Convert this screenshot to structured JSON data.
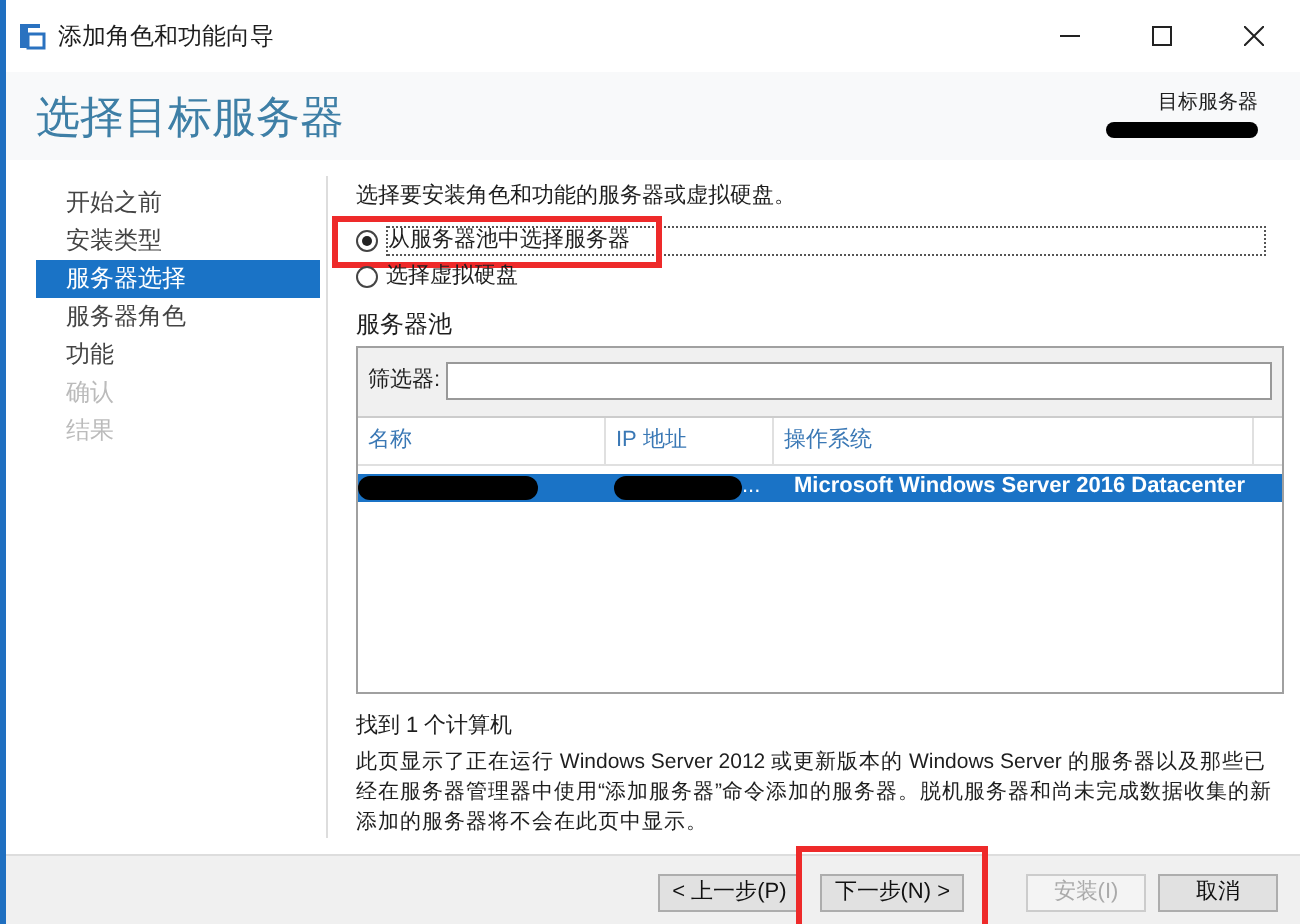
{
  "window": {
    "title": "添加角色和功能向导"
  },
  "header": {
    "title": "选择目标服务器",
    "target_label": "目标服务器"
  },
  "nav": [
    {
      "label": "开始之前",
      "selected": false,
      "disabled": false
    },
    {
      "label": "安装类型",
      "selected": false,
      "disabled": false
    },
    {
      "label": "服务器选择",
      "selected": true,
      "disabled": false
    },
    {
      "label": "服务器角色",
      "selected": false,
      "disabled": false
    },
    {
      "label": "功能",
      "selected": false,
      "disabled": false
    },
    {
      "label": "确认",
      "selected": false,
      "disabled": true
    },
    {
      "label": "结果",
      "selected": false,
      "disabled": true
    }
  ],
  "description": "选择要安装角色和功能的服务器或虚拟硬盘。",
  "options": [
    {
      "label": "从服务器池中选择服务器",
      "selected": true,
      "highlighted": true
    },
    {
      "label": "选择虚拟硬盘",
      "selected": false,
      "highlighted": false
    }
  ],
  "pool": {
    "label": "服务器池",
    "filter_label": "筛选器:",
    "columns": [
      "名称",
      "IP 地址",
      "操作系统"
    ],
    "rows": [
      {
        "selected": true,
        "ip": "...",
        "os": "Microsoft Windows Server 2016 Datacenter"
      }
    ]
  },
  "found": "找到 1 个计算机",
  "note": "此页显示了正在运行 Windows Server 2012 或更新版本的 Windows Server 的服务器以及那些已经在服务器管理器中使用“添加服务器”命令添加的服务器。脱机服务器和尚未完成数据收集的新添加的服务器将不会在此页中显示。",
  "buttons": [
    {
      "label": "< 上一步(P)",
      "disabled": false,
      "highlighted": false
    },
    {
      "label": "下一步(N) >",
      "disabled": false,
      "highlighted": true
    },
    {
      "label": "安装(I)",
      "disabled": true,
      "highlighted": false
    },
    {
      "label": "取消",
      "disabled": false,
      "highlighted": false
    }
  ]
}
